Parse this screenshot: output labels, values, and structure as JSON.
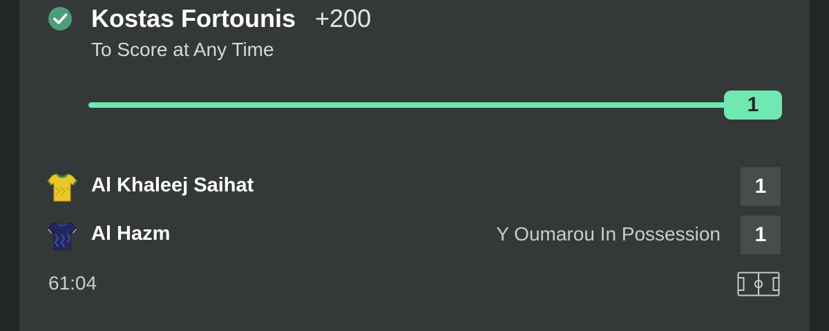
{
  "bet": {
    "status_icon": "check-circle-icon",
    "status_color": "#4c9e7a",
    "player": "Kostas Fortounis",
    "odds": "+200",
    "market": "To Score at Any Time",
    "progress_value": "1",
    "progress_fraction": 1.0,
    "accent_color": "#6fe8b2"
  },
  "match": {
    "home": {
      "name": "Al Khaleej Saihat",
      "score": "1",
      "shirt_icon": "yellow-shirt-icon"
    },
    "away": {
      "name": "Al Hazm",
      "score": "1",
      "shirt_icon": "navy-shirt-icon",
      "possession": "Y Oumarou In Possession"
    },
    "clock": "61:04",
    "pitch_icon": "pitch-icon"
  }
}
